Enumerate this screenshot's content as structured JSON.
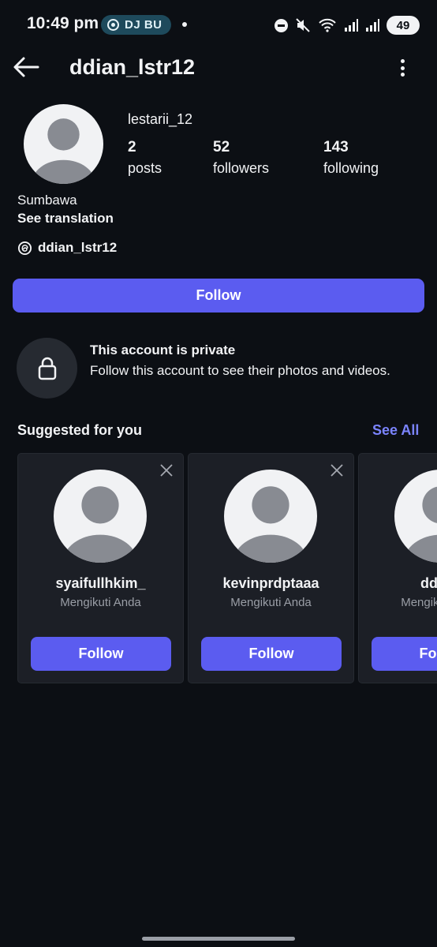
{
  "status_bar": {
    "time": "10:49 pm",
    "media_label": "DJ BU",
    "battery": "49"
  },
  "header": {
    "title": "ddian_lstr12"
  },
  "profile": {
    "display_name": "lestarii_12",
    "stats": [
      {
        "num": "2",
        "label": "posts"
      },
      {
        "num": "52",
        "label": "followers"
      },
      {
        "num": "143",
        "label": "following"
      }
    ],
    "bio": "Sumbawa",
    "see_translation": "See translation",
    "threads_handle": "ddian_lstr12",
    "follow_label": "Follow"
  },
  "private": {
    "title": "This account is private",
    "description": "Follow this account to see their photos and videos."
  },
  "suggested": {
    "title": "Suggested for you",
    "see_all": "See All",
    "cards": [
      {
        "username": "syaifullhkim_",
        "subtitle": "Mengikuti Anda",
        "follow": "Follow"
      },
      {
        "username": "kevinprdptaaa",
        "subtitle": "Mengikuti Anda",
        "follow": "Follow"
      },
      {
        "username": "ddfhrr",
        "subtitle": "Mengikuti Anda",
        "follow": "Follow"
      }
    ]
  },
  "colors": {
    "background": "#0c0f14",
    "accent": "#5b5cf0",
    "link": "#7b84ff",
    "card": "#1c1f26"
  },
  "icons": [
    "back-arrow-icon",
    "more-vertical-icon",
    "threads-icon",
    "lock-icon",
    "close-icon",
    "default-avatar-icon",
    "wifi-icon",
    "signal-icon",
    "mute-icon",
    "dnd-icon"
  ]
}
